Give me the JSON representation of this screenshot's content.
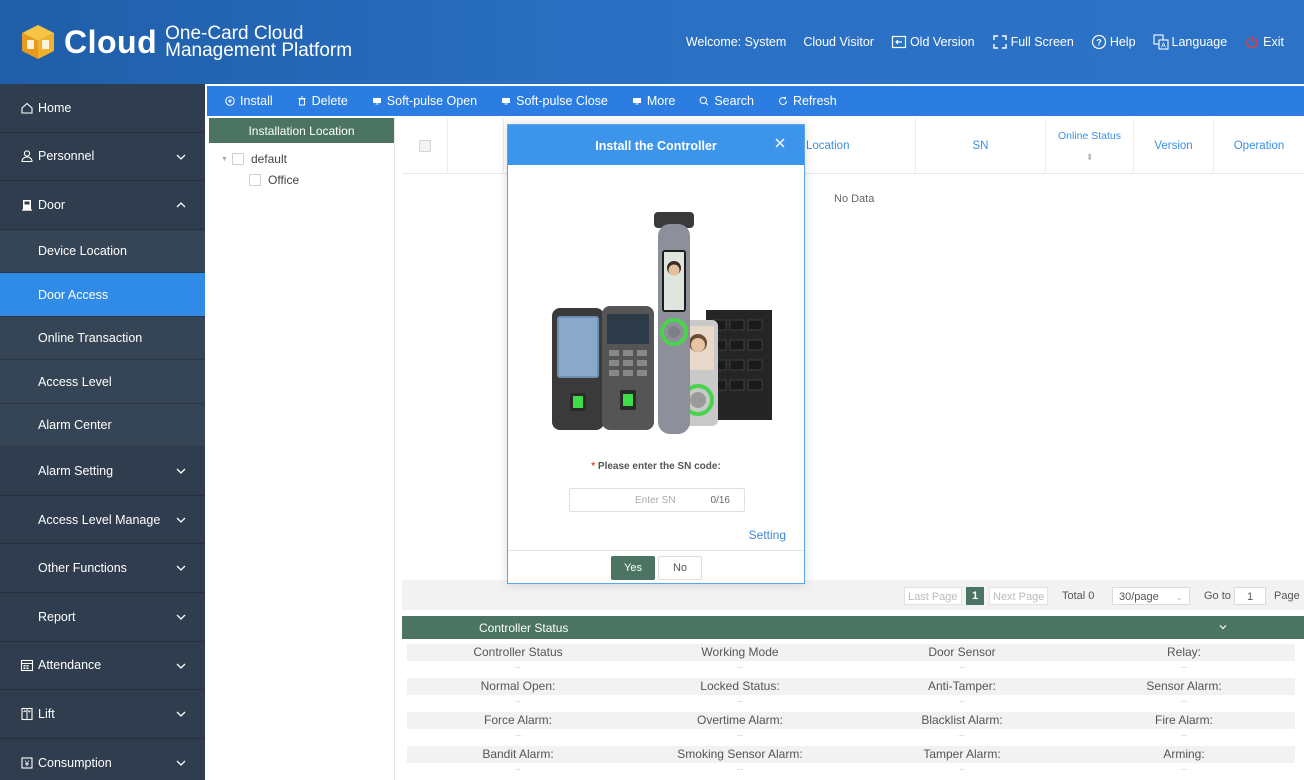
{
  "header": {
    "logo_word": "Cloud",
    "logo_sub_line1": "One-Card Cloud",
    "logo_sub_line2": "Management Platform",
    "welcome": "Welcome: System",
    "cloud_visitor": "Cloud Visitor",
    "old_version": "Old Version",
    "full_screen": "Full Screen",
    "help": "Help",
    "language": "Language",
    "exit": "Exit"
  },
  "sidebar": {
    "home": "Home",
    "personnel": "Personnel",
    "door": "Door",
    "door_sub": [
      "Device Location",
      "Door Access",
      "Online Transaction",
      "Access Level",
      "Alarm Center"
    ],
    "door_sub2": [
      "Alarm Setting",
      "Access Level Manage",
      "Other Functions",
      "Report"
    ],
    "attendance": "Attendance",
    "lift": "Lift",
    "consumption": "Consumption"
  },
  "toolbar": {
    "install": "Install",
    "delete": "Delete",
    "soft_open": "Soft-pulse Open",
    "soft_close": "Soft-pulse Close",
    "more": "More",
    "search": "Search",
    "refresh": "Refresh"
  },
  "tree": {
    "title": "Installation Location",
    "root": "default",
    "child": "Office"
  },
  "table": {
    "location": "Location",
    "sn": "SN",
    "online_status": "Online Status",
    "version": "Version",
    "operation": "Operation",
    "no_data": "No Data"
  },
  "pager": {
    "last": "Last Page",
    "current": "1",
    "next": "Next Page",
    "total": "Total 0",
    "per_page": "30/page",
    "goto": "Go to",
    "goto_value": "1",
    "page": "Page"
  },
  "status": {
    "title": "Controller Status",
    "rows": [
      [
        "Controller Status",
        "Working Mode",
        "Door Sensor",
        "Relay:"
      ],
      [
        "Normal Open:",
        "Locked Status:",
        "Anti-Tamper:",
        "Sensor Alarm:"
      ],
      [
        "Force Alarm:",
        "Overtime Alarm:",
        "Blacklist Alarm:",
        "Fire Alarm:"
      ],
      [
        "Bandit Alarm:",
        "Smoking Sensor Alarm:",
        "Tamper Alarm:",
        "Arming:"
      ]
    ],
    "empty_value": "--"
  },
  "modal": {
    "title": "Install the Controller",
    "required_mark": "*",
    "label": "Please enter the SN code:",
    "placeholder": "Enter SN",
    "counter": "0/16",
    "setting": "Setting",
    "yes": "Yes",
    "no": "No"
  },
  "colors": {
    "header_blue": "#2a6fc2",
    "sidebar_dark": "#2f3d4e",
    "active_blue": "#2f8be6",
    "toolbar_blue": "#2b7de2",
    "accent_green": "#4b7463",
    "exit_red": "#e03c3c"
  }
}
